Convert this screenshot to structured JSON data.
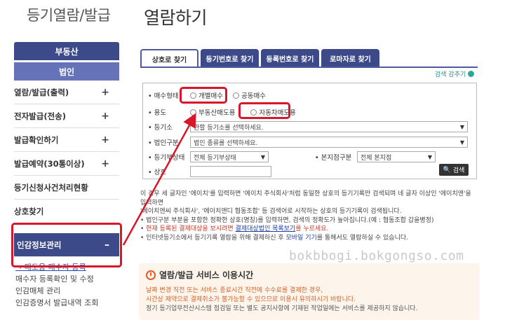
{
  "header": {
    "sidebar_title": "등기열람/발급",
    "page_title": "열람하기"
  },
  "sidebar": {
    "top_button": "부동산",
    "second_button": "법인",
    "items": [
      {
        "label": "열람/발급(출력)",
        "plus": "+"
      },
      {
        "label": "전자발급(전송)",
        "plus": "+"
      },
      {
        "label": "발급확인하기",
        "plus": "+"
      },
      {
        "label": "발급예약(30통이상)",
        "plus": "+"
      },
      {
        "label": "등기신청사건처리현황",
        "plus": ""
      },
      {
        "label": "상호찾기",
        "plus": ""
      }
    ],
    "active_item": {
      "label": "인감정보관리",
      "toggle": "–"
    },
    "sub_items": [
      {
        "label": "매도용 매수자 등록",
        "arrow": "→"
      },
      {
        "label": "매수자 등록확인 및 수정"
      },
      {
        "label": "인감매체 관리"
      },
      {
        "label": "인감증명서 발급내역 조회"
      }
    ]
  },
  "tabs": [
    {
      "label": "상호로 찾기",
      "active": true
    },
    {
      "label": "등기번호로 찾기",
      "active": false
    },
    {
      "label": "등록번호로 찾기",
      "active": false
    },
    {
      "label": "로마자로 찾기",
      "active": false
    }
  ],
  "search_toggle": "검색 감추기",
  "form": {
    "buyer_type": {
      "label": "매수형태",
      "options": [
        "개별매수",
        "공동매수"
      ]
    },
    "usage": {
      "label": "용도",
      "options": [
        "부동산매도용",
        "자동차매도용"
      ]
    },
    "registry_office": {
      "label": "등기소",
      "placeholder": "관할 등기소를 선택하세요."
    },
    "corp_type": {
      "label": "법인구분",
      "placeholder": "법인 종류를 선택하세요."
    },
    "registry_status": {
      "label": "등기부상태",
      "value": "전체 등기부상태"
    },
    "branch_type": {
      "label": "본지점구분",
      "value": "전체 본지점"
    },
    "trade_name": {
      "label": "상호"
    },
    "search_button": "검색"
  },
  "notes": {
    "line1": "이 경우 세 글자인 '에이치'를 입력하면 '에이치 주식회사'처럼 동일한 상호의 등기기록만 검색되며 네 글자 이상인 '에이치앤'을 입력하면",
    "line2": "'에이치엔씨 주식회사', '에이치앤디 협동조합' 등 검색어로 시작하는 상호의 등기기록이 검색됩니다.",
    "line3": "법인구분 부분을 포함한 정확한 상호(명칭)를 입력하면, 검색의 정확도가 높아집니다.(예 : 협동조합 갑을병정)",
    "line4_pre": "현재 등록된 결제대상을 보시려면 ",
    "line4_link": "결제대상법인 목록보기",
    "line4_post": "를 누르세요.",
    "line5_pre": "인터넷등기소에서 등기기록 열람을 위해 결제하신 후 ",
    "line5_blue": "모바일 기기",
    "line5_post": "를 통해서도 열람하실 수 있습니다."
  },
  "watermark": "bokbbogi.bokgongso.com",
  "service": {
    "title": "열람/발급 서비스 이용시간",
    "line1": "날짜 변경 직전 또는 서비스 종료시간 직전에 수수료를 결제한 경우,",
    "line2": "시간상 제약으로 결제취소가 불가능할 수 있으므로 이용시 유의하시기 바랍니다.",
    "line3": "정기 등기업무전산시스템 점검일 또는 별도 공지사항에 기재된 작업일에는 서비스를 제공하지 않습니다."
  },
  "colors": {
    "nav_dark": "#3d4a8a",
    "highlight": "#d8172a",
    "accent_orange": "#e85a24"
  }
}
